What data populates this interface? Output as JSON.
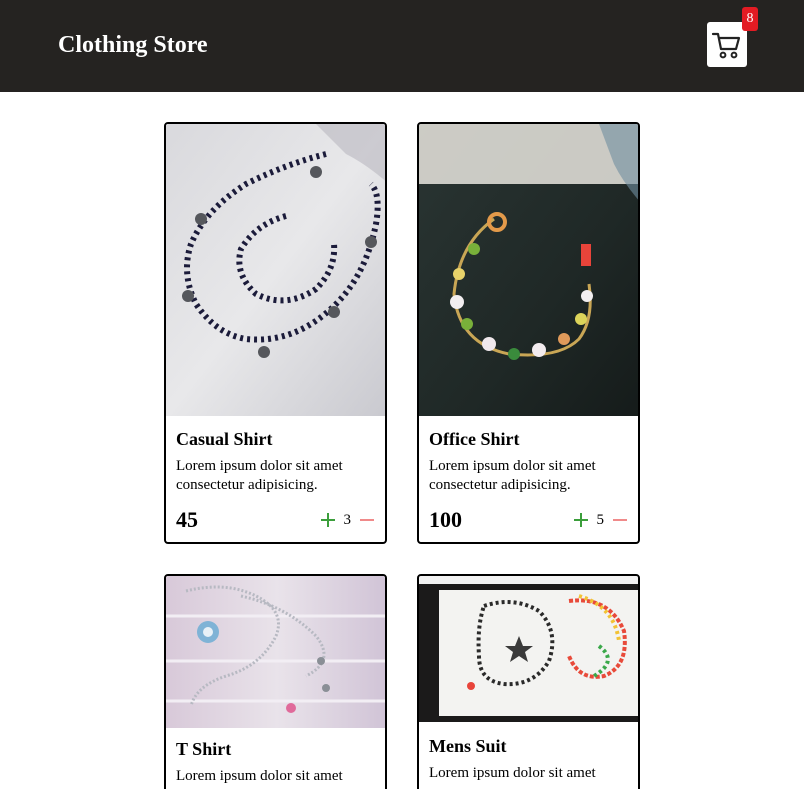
{
  "header": {
    "brand": "Clothing Store",
    "cart_count": "8",
    "cart_icon": "shopping-cart-icon"
  },
  "products": [
    {
      "name": "Casual Shirt",
      "desc": "Lorem ipsum dolor sit amet consectetur adipisicing.",
      "price": "45",
      "qty": "3"
    },
    {
      "name": "Office Shirt",
      "desc": "Lorem ipsum dolor sit amet consectetur adipisicing.",
      "price": "100",
      "qty": "5"
    },
    {
      "name": "T Shirt",
      "desc": "Lorem ipsum dolor sit amet"
    },
    {
      "name": "Mens Suit",
      "desc": "Lorem ipsum dolor sit amet"
    }
  ],
  "colors": {
    "header_bg": "#252321",
    "badge": "#e31b23",
    "plus": "#3b9e3b",
    "minus": "#f08a8a"
  }
}
